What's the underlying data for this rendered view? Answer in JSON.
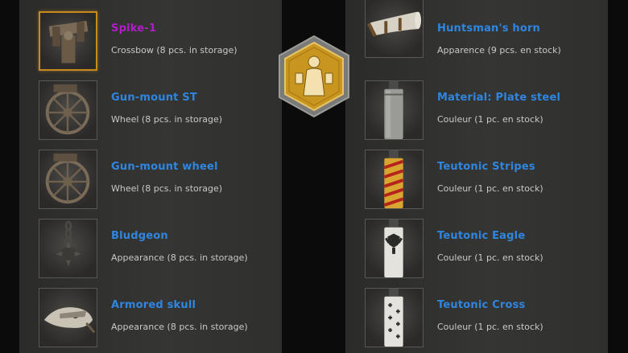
{
  "left_items": [
    {
      "name": "Spike-1",
      "desc": "Crossbow (8 pcs. in storage)",
      "icon": "crossbow-icon"
    },
    {
      "name": "Gun-mount ST",
      "desc": "Wheel (8 pcs. in storage)",
      "icon": "wheel-icon"
    },
    {
      "name": "Gun-mount wheel",
      "desc": "Wheel (8 pcs. in storage)",
      "icon": "wheel-icon"
    },
    {
      "name": "Bludgeon",
      "desc": "Appearance (8 pcs. in storage)",
      "icon": "mace-icon"
    },
    {
      "name": "Armored skull",
      "desc": "Appearance (8 pcs. in storage)",
      "icon": "skull-icon"
    }
  ],
  "right_items": [
    {
      "name": "Huntsman's horn",
      "desc": "Apparence (9 pcs. en stock)",
      "icon": "horn-icon"
    },
    {
      "name": "Material: Plate steel",
      "desc": "Couleur (1 pc. en stock)",
      "icon": "paint-can-icon"
    },
    {
      "name": "Teutonic Stripes",
      "desc": "Couleur (1 pc. en stock)",
      "icon": "paint-can-icon"
    },
    {
      "name": "Teutonic Eagle",
      "desc": "Couleur (1 pc. en stock)",
      "icon": "paint-can-icon"
    },
    {
      "name": "Teutonic Cross",
      "desc": "Couleur (1 pc. en stock)",
      "icon": "paint-can-icon"
    }
  ],
  "colors": {
    "rare_name": "#b01ec8",
    "common_name": "#2f86e0",
    "selected_border": "#c98a1c",
    "badge_gold": "#c8951f"
  },
  "selected_item": "Spike-1",
  "center_badge": {
    "icon": "beer-maiden-badge-icon"
  }
}
